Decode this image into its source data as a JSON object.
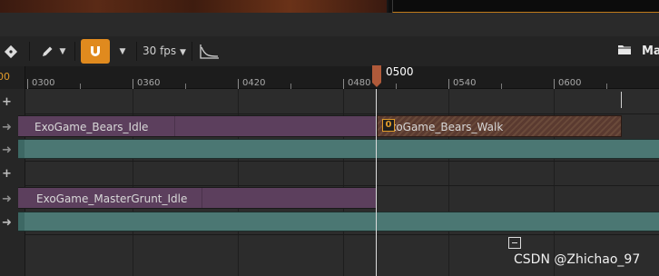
{
  "toolbar": {
    "fps_label": "30 fps",
    "menu_truncated": "Ma",
    "icons": [
      "key-add-icon",
      "pencil-icon",
      "magnet-snap-icon",
      "curve-editor-icon",
      "folder-icon"
    ],
    "colors": {
      "snap_active": "#e08a1e"
    }
  },
  "ruler": {
    "left_label": "00",
    "ticks": [
      "0300",
      "0360",
      "0420",
      "0480",
      "0540",
      "0600"
    ],
    "playhead_label": "0500"
  },
  "tracks": {
    "sections": [
      {
        "label": "ExoGame_Bears_Idle"
      },
      {
        "label": "ExoGame_Bears_Walk",
        "key_badge": "0"
      },
      {
        "label": "ExoGame_MasterGrunt_Idle"
      }
    ],
    "colors": {
      "anim_section": "#5c3f5d",
      "weight_track": "#4b7773",
      "playhead_marker": "#b05a3a",
      "key_badge": "#e09a2a"
    }
  },
  "watermark": "CSDN @Zhichao_97"
}
